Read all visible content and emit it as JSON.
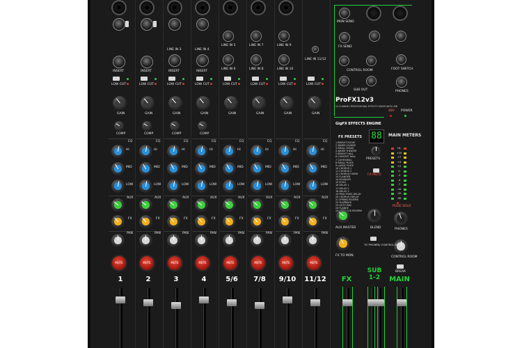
{
  "mixer": {
    "brand_model": "ProFX12v3",
    "model_subtitle": "12-CHANNEL PROFESSIONAL EFFECTS MIXER WITH USB",
    "effects_engine": "GigFX EFFECTS ENGINE",
    "fx_presets_title": "FX PRESETS",
    "fx_display": "88",
    "presets_label": "PRESETS",
    "fx_mute_label": "FX MUTE",
    "fx_presets": [
      "BRIGHT ROOM",
      "WARM LOUNGE",
      "SMALL STAGE",
      "WARM THEATER",
      "BRIGHT HALL",
      "CONCERT HALL",
      "CATHEDRAL",
      "SMALL PLATE",
      "LARGE PLATE",
      "CHORUS 1",
      "CHORUS 2",
      "CHORUS+VERB",
      "FLANGER",
      "DOUBLER",
      "ECHO",
      "DELAY 1",
      "DELAY 2",
      "DELAY 3",
      "PING PONG DELAY",
      "CHORUS+DELAY",
      "SPRING REVERB",
      "SLAPBACK",
      "AUTO PAN",
      "FLANGE",
      "SLAPBACK REVERB"
    ],
    "right_panel": {
      "mon_send": "MON SEND",
      "fx_send": "FX SEND",
      "control_room": "CONTROL ROOM",
      "sub_out": "SUB OUT",
      "foot_switch": "FOOT SWITCH",
      "phones": "PHONES",
      "power": "POWER",
      "phantom": "48V",
      "main_meters": "MAIN METERS",
      "rude_solo": "RUDE SOLO",
      "phones_knob": "PHONES",
      "control_room_knob": "CONTROL ROOM",
      "aux_master": "AUX MASTER",
      "fx_to_mon": "FX TO MON",
      "blend": "BLEND",
      "to_phones": "TO PHONES/ CONTROL RM",
      "meter_scale": [
        "OL",
        "+10",
        "+7",
        "+4",
        "+2",
        "0",
        "-2",
        "-4",
        "-7",
        "-10",
        "-20",
        "-30"
      ],
      "fader_fx": "FX",
      "fader_sub": "SUB 1-2",
      "fader_main": "MAIN",
      "break_label": "BREAK"
    },
    "strip_labels": {
      "gain": "GAIN",
      "comp": "COMP",
      "eq": "EQ",
      "hi": "HI",
      "mid": "MID",
      "low": "LOW",
      "aux": "AUX",
      "fx": "FX",
      "pan": "PAN",
      "mute": "MUTE",
      "insert": "INSERT",
      "low_cut": "LOW CUT",
      "line_in_11_12": "LINE IN 11/12",
      "line_in_3": "LINE IN 3",
      "line_in_4": "LINE IN 4",
      "line_in_5_6": "LINE IN 5",
      "line_in_6": "LINE IN 6",
      "line_in_7": "LINE IN 7",
      "line_in_8": "LINE IN 8",
      "line_in_9": "LINE IN 9",
      "line_in_10": "LINE IN 10"
    },
    "channels": [
      "1",
      "2",
      "3",
      "4",
      "5/6",
      "7/8",
      "9/10",
      "11/12"
    ],
    "colors": {
      "panel": "#1b1b1b",
      "accent_green": "#22d13a",
      "eq_blue": "#2a8fd8",
      "aux_green": "#3fcf3f",
      "fx_yellow": "#f2b01c",
      "pan_white": "#d8d8d8",
      "mute_red": "#c8281e"
    }
  }
}
